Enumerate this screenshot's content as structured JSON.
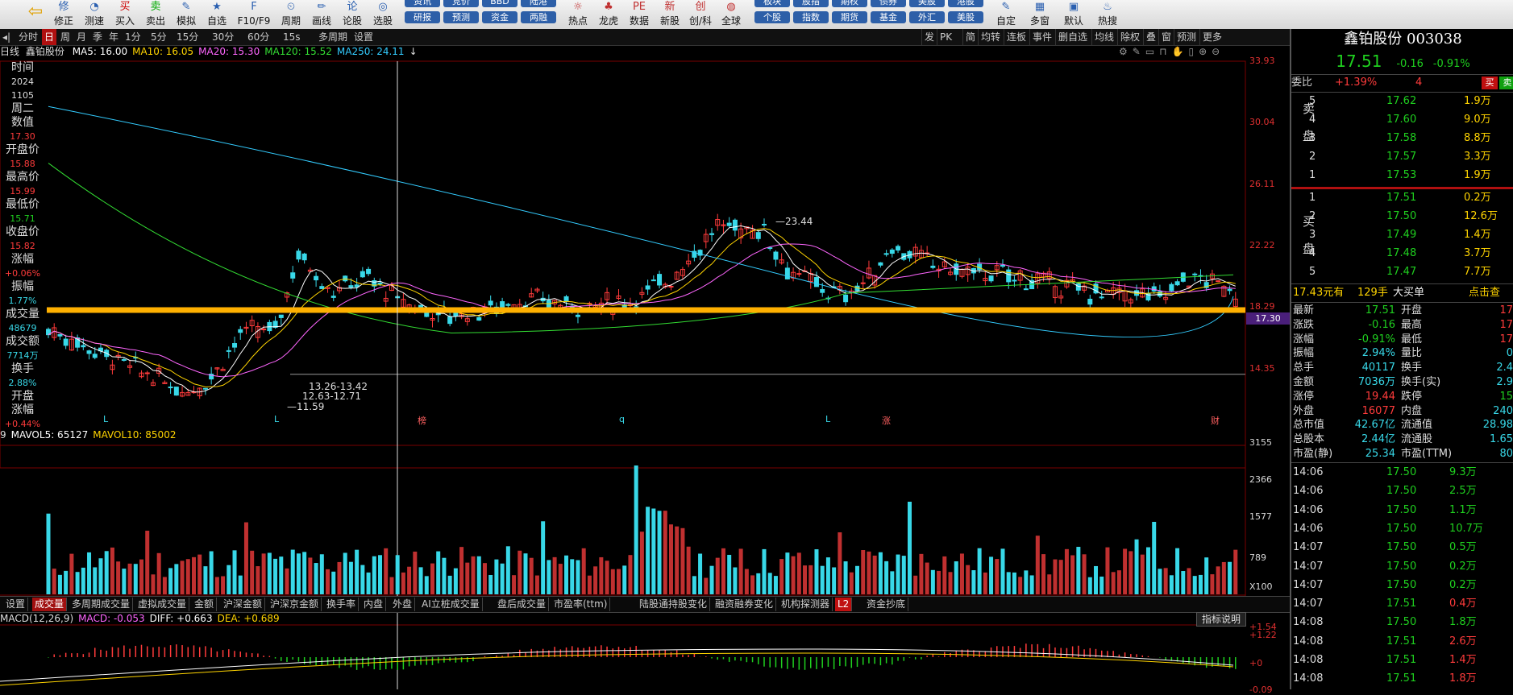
{
  "toolbar": {
    "buttons": [
      {
        "label": "修正",
        "icon": "修"
      },
      {
        "label": "测速",
        "icon": "◔"
      },
      {
        "label": "买入",
        "icon": "买"
      },
      {
        "label": "卖出",
        "icon": "卖"
      },
      {
        "label": "模拟",
        "icon": "✎"
      },
      {
        "label": "自选",
        "icon": "★"
      },
      {
        "label": "F10/F9",
        "icon": "F"
      },
      {
        "label": "周期",
        "icon": "⏲"
      },
      {
        "label": "画线",
        "icon": "✏"
      },
      {
        "label": "论股",
        "icon": "论"
      },
      {
        "label": "选股",
        "icon": "◎"
      }
    ],
    "pills_top": [
      "资讯",
      "竞价",
      "BBD",
      "陆港"
    ],
    "pills": [
      "研报",
      "预测",
      "资金",
      "两融"
    ],
    "mid_buttons": [
      {
        "label": "热点",
        "icon": "☼"
      },
      {
        "label": "龙虎",
        "icon": "♣"
      },
      {
        "label": "数据",
        "icon": "PE"
      },
      {
        "label": "新股",
        "icon": "新"
      },
      {
        "label": "创/科",
        "icon": "创"
      },
      {
        "label": "全球",
        "icon": "◍"
      }
    ],
    "pills2_top": [
      "板块",
      "股指",
      "期权",
      "债券",
      "美股",
      "港股"
    ],
    "pills2": [
      "个股",
      "指数",
      "期货",
      "基金",
      "外汇",
      "美股"
    ],
    "right_buttons": [
      {
        "label": "自定",
        "icon": "✎"
      },
      {
        "label": "多窗",
        "icon": "▦"
      },
      {
        "label": "默认",
        "icon": "▣"
      },
      {
        "label": "热搜",
        "icon": "♨"
      }
    ]
  },
  "periods": [
    "分时",
    "日",
    "周",
    "月",
    "季",
    "年",
    "1分",
    "5分",
    "15分",
    "30分",
    "60分",
    "15s",
    "多周期",
    "设置"
  ],
  "period_selected": "日",
  "right_tools": [
    "发",
    "PK",
    "简",
    "均转",
    "连板",
    "事件",
    "删自选",
    "均线",
    "除权",
    "叠",
    "窗",
    "预测",
    "更多"
  ],
  "chart_legend": {
    "label": "日线",
    "name": "鑫铂股份",
    "items": [
      {
        "text": "MA5: 16.00",
        "color": "#ffffff"
      },
      {
        "text": "MA10: 16.05",
        "color": "#ffd400"
      },
      {
        "text": "MA20: 15.30",
        "color": "#ff66ff"
      },
      {
        "text": "MA120: 15.52",
        "color": "#33dd33"
      },
      {
        "text": "MA250: 24.11",
        "color": "#33ccff"
      }
    ]
  },
  "left_info": [
    {
      "k": "时间"
    },
    {
      "v": "2024",
      "c": "#ddd"
    },
    {
      "v": "1105",
      "c": "#ddd"
    },
    {
      "v": "周二",
      "c": "#ddd",
      "big": true
    },
    {
      "k": "数值"
    },
    {
      "v": "17.30",
      "c": "#ff3b3b"
    },
    {
      "k": "开盘价"
    },
    {
      "v": "15.88",
      "c": "#ff3b3b"
    },
    {
      "k": "最高价"
    },
    {
      "v": "15.99",
      "c": "#ff3b3b"
    },
    {
      "k": "最低价"
    },
    {
      "v": "15.71",
      "c": "#1fd01f"
    },
    {
      "k": "收盘价"
    },
    {
      "v": "15.82",
      "c": "#ff3b3b"
    },
    {
      "k": "涨幅"
    },
    {
      "v": "+0.06%",
      "c": "#ff3b3b"
    },
    {
      "k": "振幅"
    },
    {
      "v": "1.77%",
      "c": "#38d8e8"
    },
    {
      "k": "成交量"
    },
    {
      "v": "48679",
      "c": "#38d8e8"
    },
    {
      "k": "成交额"
    },
    {
      "v": "7714万",
      "c": "#38d8e8"
    },
    {
      "k": "换手"
    },
    {
      "v": "2.88%",
      "c": "#38d8e8"
    },
    {
      "k": "开盘"
    },
    {
      "k": "涨幅"
    },
    {
      "v": "+0.44%",
      "c": "#ff3b3b"
    }
  ],
  "price_axis": [
    "33.93",
    "30.04",
    "26.11",
    "22.22",
    "18.29",
    "14.35"
  ],
  "price_marker": "17.30",
  "annotations": {
    "high": "23.44",
    "low": "11.59",
    "range1": "13.26-13.42",
    "range2": "12.63-12.71",
    "events": [
      "L",
      "L",
      "榜",
      "q",
      "L",
      "涨",
      "财"
    ]
  },
  "vol_legend": {
    "items": [
      {
        "text": "9",
        "color": "#ddd"
      },
      {
        "text": "MAVOL5: 65127",
        "color": "#ffffff"
      },
      {
        "text": "MAVOL10: 85002",
        "color": "#ffd400"
      }
    ]
  },
  "vol_axis": [
    "3155",
    "2366",
    "1577",
    "789",
    "X100"
  ],
  "indicator_tabs": [
    "设置",
    "成交量",
    "多周期成交量",
    "虚拟成交量",
    "金额",
    "沪深金额",
    "沪深京金额",
    "换手率",
    "内盘",
    "外盘",
    "AI立桩成交量",
    "盘后成交量",
    "市盈率(ttm)",
    "陆股通持股变化",
    "融资融券变化",
    "机构探测器",
    "L2",
    "资金抄底"
  ],
  "indicator_selected": "成交量",
  "macd_legend": {
    "items": [
      {
        "text": "MACD(12,26,9)",
        "color": "#ddd"
      },
      {
        "text": "MACD: -0.053",
        "color": "#ff66ff"
      },
      {
        "text": "DIFF: +0.663",
        "color": "#ffffff"
      },
      {
        "text": "DEA: +0.689",
        "color": "#ffd400"
      }
    ]
  },
  "macd_axis": [
    "+1.54",
    "+1.22",
    "+0",
    "-0.09"
  ],
  "macd_help": "指标说明",
  "stock": {
    "name": "鑫铂股份",
    "code": "003038",
    "price": "17.51",
    "change": "-0.16",
    "pct": "-0.91%"
  },
  "weibi": {
    "label": "委比",
    "pct": "+1.39%",
    "diff": "4",
    "buy": "买",
    "sell": "卖"
  },
  "sell_side_label": "卖盘",
  "buy_side_label": "买盘",
  "asks": [
    {
      "lvl": "5",
      "price": "17.62",
      "vol": "1.9万"
    },
    {
      "lvl": "4",
      "price": "17.60",
      "vol": "9.0万"
    },
    {
      "lvl": "3",
      "price": "17.58",
      "vol": "8.8万"
    },
    {
      "lvl": "2",
      "price": "17.57",
      "vol": "3.3万"
    },
    {
      "lvl": "1",
      "price": "17.53",
      "vol": "1.9万"
    }
  ],
  "bids": [
    {
      "lvl": "1",
      "price": "17.51",
      "vol": "0.2万"
    },
    {
      "lvl": "2",
      "price": "17.50",
      "vol": "12.6万"
    },
    {
      "lvl": "3",
      "price": "17.49",
      "vol": "1.4万"
    },
    {
      "lvl": "4",
      "price": "17.48",
      "vol": "3.7万"
    },
    {
      "lvl": "5",
      "price": "17.47",
      "vol": "7.7万"
    }
  ],
  "big_order": {
    "price": "17.43元有",
    "qty": "129手",
    "type": "大买单",
    "link": "点击查"
  },
  "quote": [
    {
      "k1": "最新",
      "v1": "17.51",
      "k2": "开盘",
      "v2": "17"
    },
    {
      "k1": "涨跌",
      "v1": "-0.16",
      "k2": "最高",
      "v2": "17"
    },
    {
      "k1": "涨幅",
      "v1": "-0.91%",
      "k2": "最低",
      "v2": "17"
    },
    {
      "k1": "振幅",
      "v1": "2.94%",
      "k2": "量比",
      "v2": "0"
    },
    {
      "k1": "总手",
      "v1": "40117",
      "k2": "换手",
      "v2": "2.4"
    },
    {
      "k1": "金额",
      "v1": "7036万",
      "k2": "换手(实)",
      "v2": "2.9"
    },
    {
      "k1": "涨停",
      "v1": "19.44",
      "k2": "跌停",
      "v2": "15"
    },
    {
      "k1": "外盘",
      "v1": "16077",
      "k2": "内盘",
      "v2": "240"
    },
    {
      "k1": "总市值",
      "v1": "42.67亿",
      "k2": "流通值",
      "v2": "28.98"
    },
    {
      "k1": "总股本",
      "v1": "2.44亿",
      "k2": "流通股",
      "v2": "1.65"
    },
    {
      "k1": "市盈(静)",
      "v1": "25.34",
      "k2": "市盈(TTM)",
      "v2": "80"
    }
  ],
  "ticks": [
    {
      "t": "14:06",
      "p": "17.50",
      "v": "9.3万",
      "c": "#1fd01f"
    },
    {
      "t": "14:06",
      "p": "17.50",
      "v": "2.5万",
      "c": "#1fd01f"
    },
    {
      "t": "14:06",
      "p": "17.50",
      "v": "1.1万",
      "c": "#1fd01f"
    },
    {
      "t": "14:06",
      "p": "17.50",
      "v": "10.7万",
      "c": "#1fd01f"
    },
    {
      "t": "14:07",
      "p": "17.50",
      "v": "0.5万",
      "c": "#1fd01f"
    },
    {
      "t": "14:07",
      "p": "17.50",
      "v": "0.2万",
      "c": "#1fd01f"
    },
    {
      "t": "14:07",
      "p": "17.50",
      "v": "0.2万",
      "c": "#1fd01f"
    },
    {
      "t": "14:07",
      "p": "17.51",
      "v": "0.4万",
      "c": "#ff3b3b"
    },
    {
      "t": "14:08",
      "p": "17.50",
      "v": "1.8万",
      "c": "#1fd01f"
    },
    {
      "t": "14:08",
      "p": "17.51",
      "v": "2.6万",
      "c": "#ff3b3b"
    },
    {
      "t": "14:08",
      "p": "17.51",
      "v": "1.4万",
      "c": "#ff3b3b"
    },
    {
      "t": "14:08",
      "p": "17.51",
      "v": "1.8万",
      "c": "#ff3b3b"
    }
  ],
  "colors": {
    "up": "#ff3b3b",
    "down": "#1fd01f",
    "cyan": "#38d8e8",
    "yellow": "#ffd400",
    "orange": "#ffb000"
  }
}
